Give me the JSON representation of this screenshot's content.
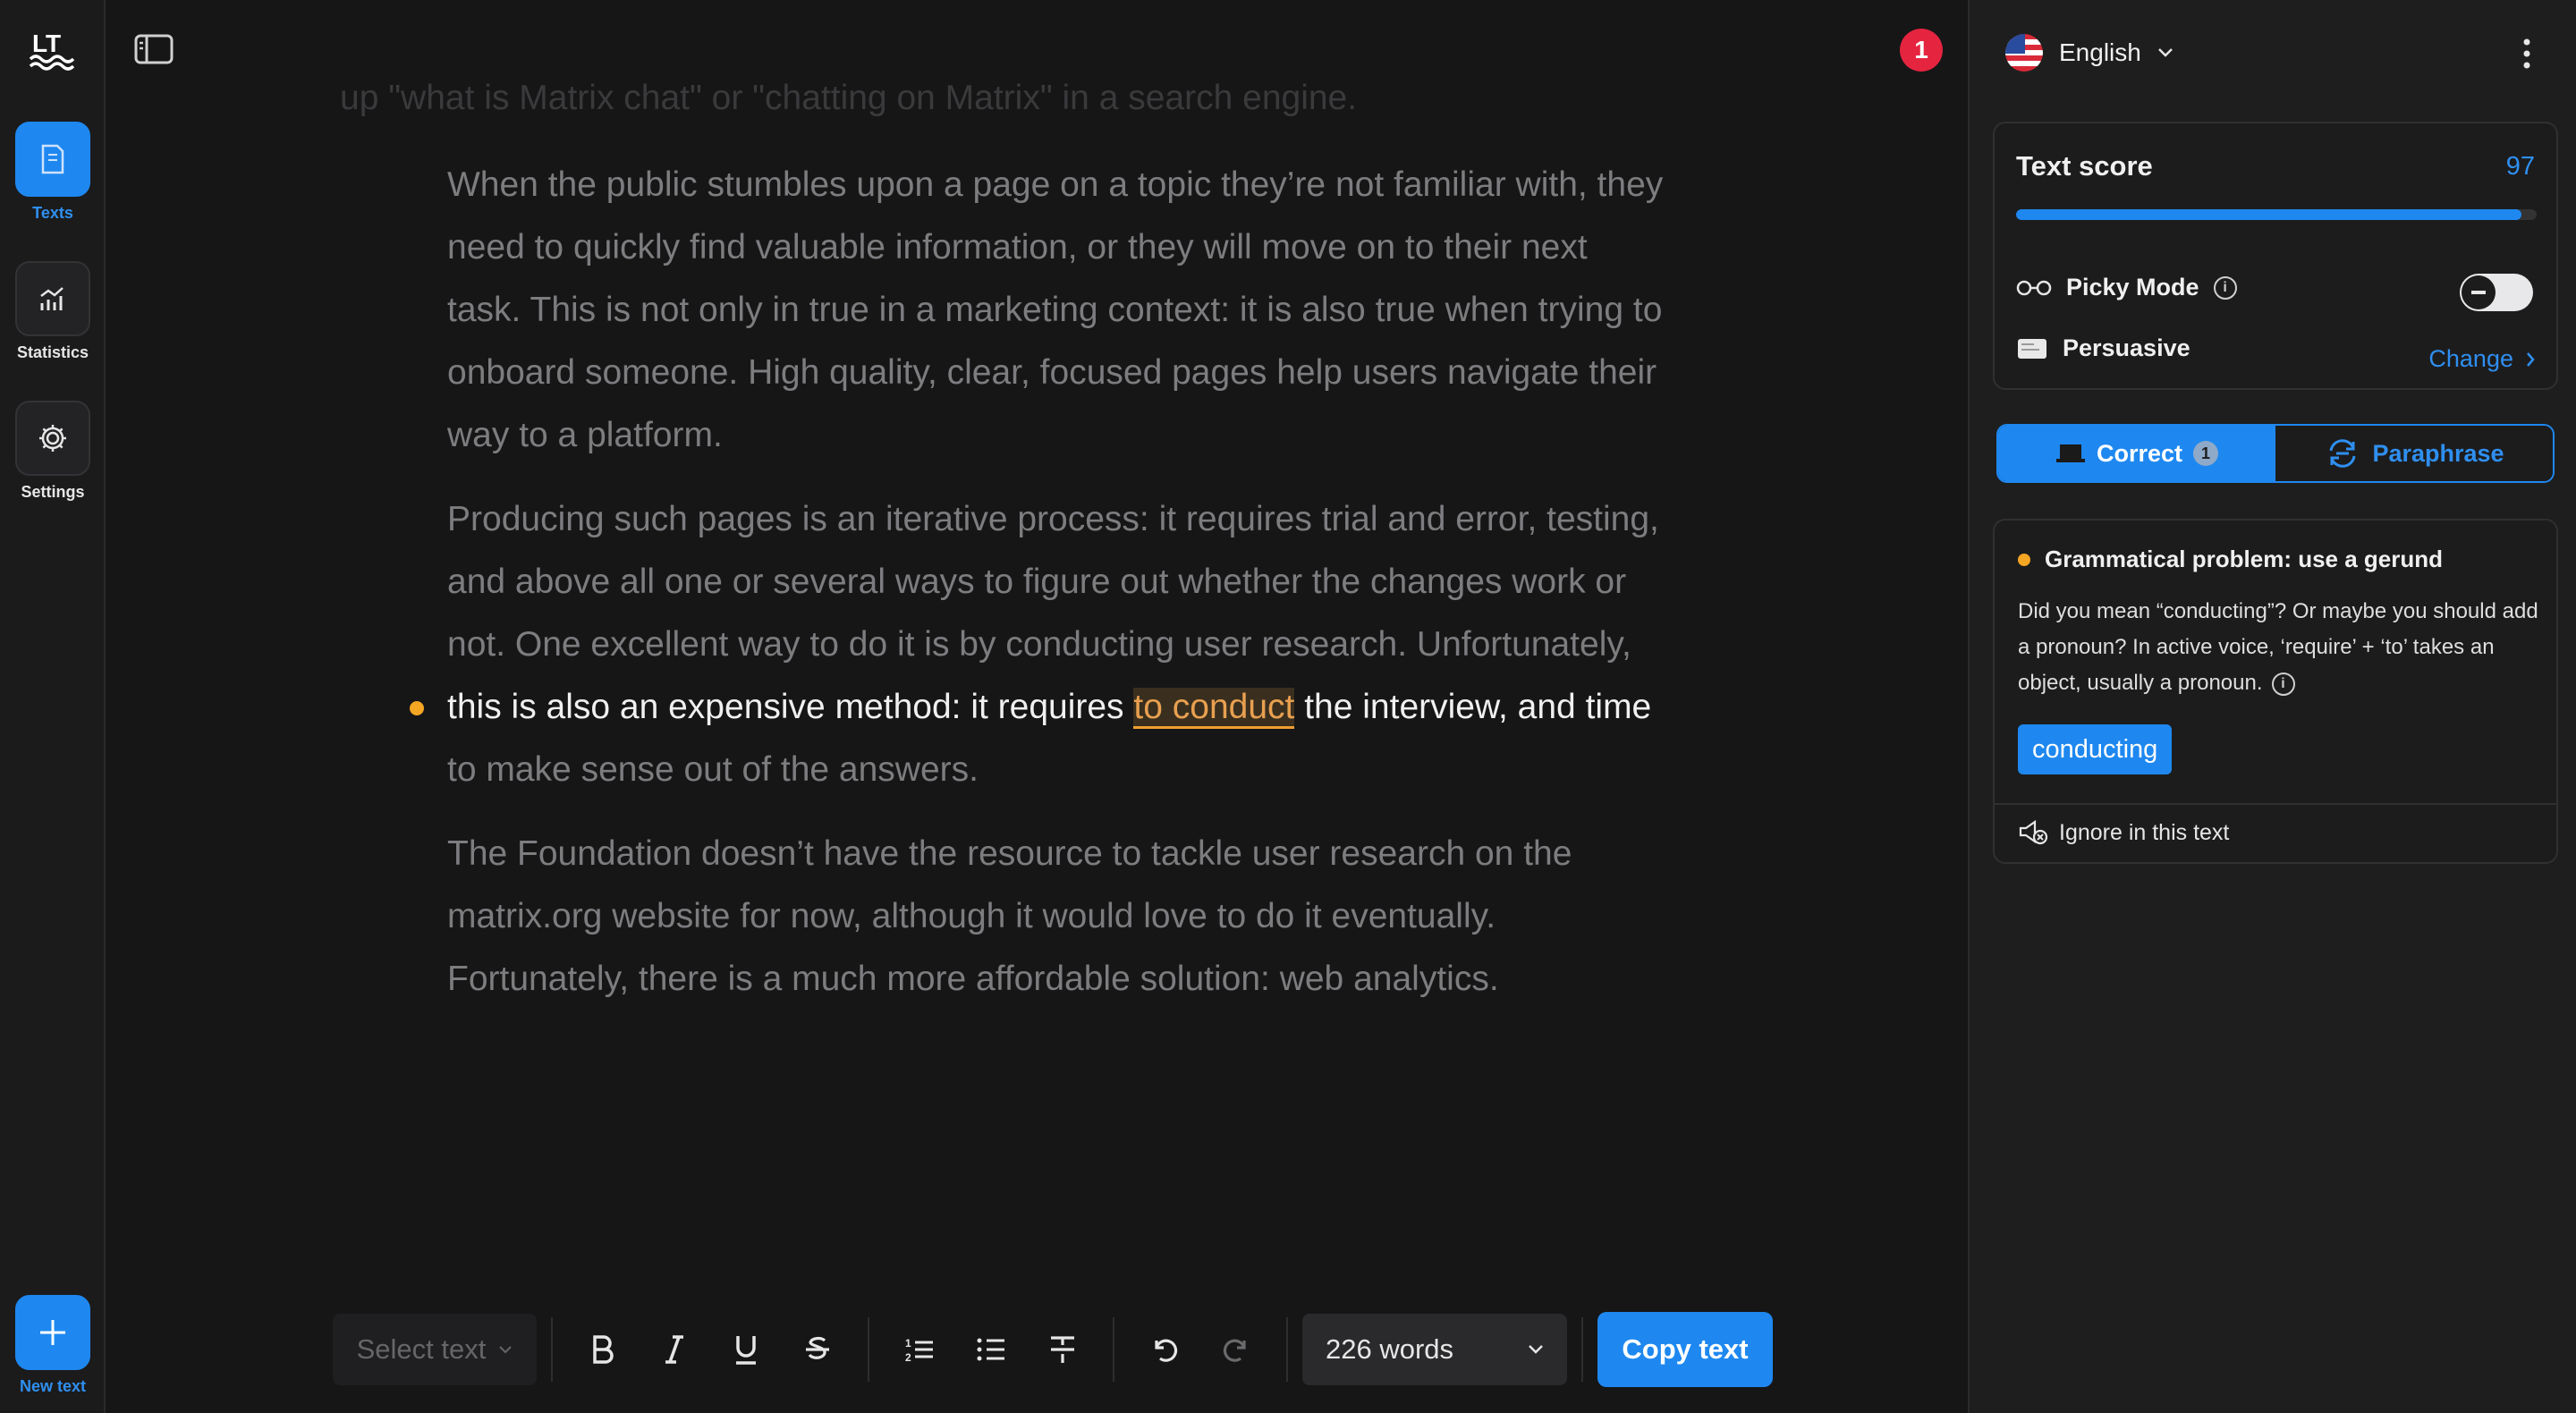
{
  "rail": {
    "items": [
      {
        "label": "Texts",
        "icon": "document-icon"
      },
      {
        "label": "Statistics",
        "icon": "chart-icon"
      },
      {
        "label": "Settings",
        "icon": "gear-icon"
      }
    ],
    "new_text": "New text"
  },
  "header": {
    "notification_count": "1"
  },
  "editor": {
    "faded_line": "up \"what is Matrix chat\" or \"chatting on Matrix\" in a search engine.",
    "p1": [
      "When the public stumbles upon a page on a topic they’re not familiar with, they",
      "need to quickly find valuable information, or they will move on to their next",
      "task. This is not only in true in a marketing context: it is also true when trying to",
      "onboard someone. High quality, clear, focused pages help users navigate their",
      "way to a platform."
    ],
    "p2": [
      "Producing such pages is an iterative process: it requires trial and error, testing,",
      "and above all one or several ways to figure out whether the changes work or",
      "not. One excellent way to do it is by conducting user research. Unfortunately,"
    ],
    "active_line": {
      "before": "this is also an expensive method: it requires ",
      "highlight": "to conduct",
      "after": " the interview, and time"
    },
    "p2_end": "to make sense out of the answers.",
    "p3": [
      "The Foundation doesn’t have the resource to tackle user research on the",
      "matrix.org website for now, although it would love to do it eventually.",
      "Fortunately, there is a much more affordable solution: web analytics."
    ]
  },
  "toolbar": {
    "select_text": "Select text",
    "word_count": "226 words",
    "copy_label": "Copy text"
  },
  "panel": {
    "language": "English",
    "score_label": "Text score",
    "score_value": "97",
    "score_fraction": 0.97,
    "picky_label": "Picky Mode",
    "style_label": "Persuasive",
    "change_label": "Change",
    "tab_correct": "Correct",
    "tab_correct_count": "1",
    "tab_paraphrase": "Paraphrase",
    "issue": {
      "title": "Grammatical problem: use a gerund",
      "description": "Did you mean “conducting”? Or maybe you should add a pronoun? In active voice, ‘require’ + ‘to’ takes an object, usually a pronoun.",
      "suggestion": "conducting",
      "ignore_label": "Ignore in this text"
    }
  },
  "colors": {
    "accent": "#1e88f0",
    "warning": "#f5a623",
    "badge": "#e5243f"
  }
}
